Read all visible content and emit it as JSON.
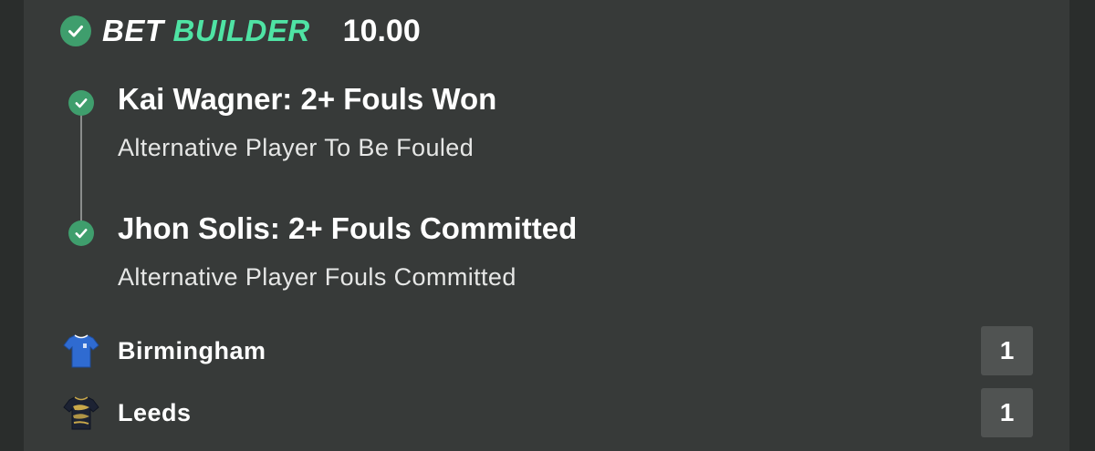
{
  "header": {
    "brand_bet": "BET",
    "brand_builder": "BUILDER",
    "odds": "10.00"
  },
  "legs": [
    {
      "title": "Kai Wagner: 2+ Fouls Won",
      "subtitle": "Alternative Player To Be Fouled",
      "status": "won"
    },
    {
      "title": "Jhon Solis: 2+ Fouls Committed",
      "subtitle": "Alternative Player Fouls Committed",
      "status": "won"
    }
  ],
  "teams": [
    {
      "name": "Birmingham",
      "score": "1",
      "kit_icon": "blue-shirt-icon"
    },
    {
      "name": "Leeds",
      "score": "1",
      "kit_icon": "dark-patterned-shirt-icon"
    }
  ],
  "colors": {
    "accent_green": "#4fe3a4",
    "check_green": "#3f9e6d",
    "card_bg": "#373a39"
  }
}
